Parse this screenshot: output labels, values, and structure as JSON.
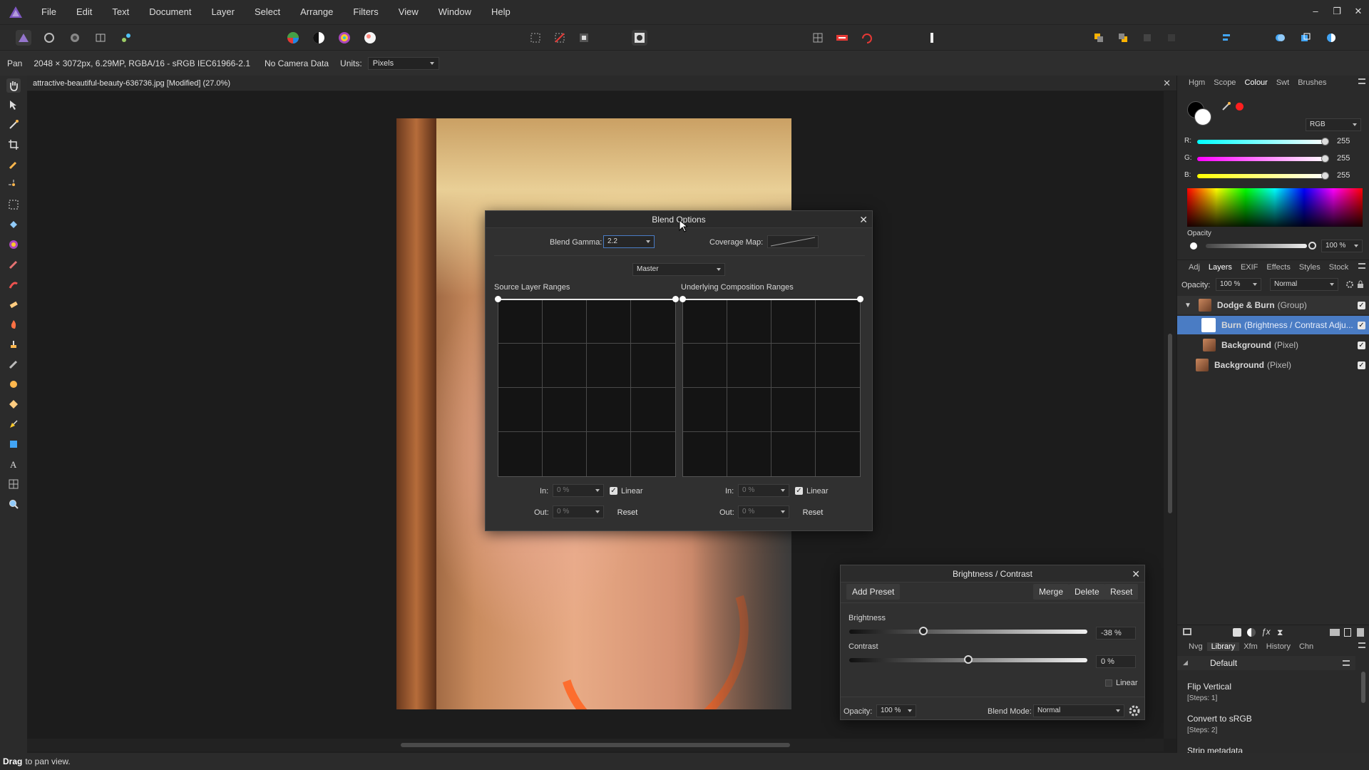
{
  "menubar": {
    "items": [
      "File",
      "Edit",
      "Text",
      "Document",
      "Layer",
      "Select",
      "Arrange",
      "Filters",
      "View",
      "Window",
      "Help"
    ],
    "window_controls": [
      "–",
      "❐",
      "✕"
    ]
  },
  "context": {
    "tool": "Pan",
    "doc_info": "2048 × 3072px, 6.29MP, RGBA/16 - sRGB IEC61966-2.1",
    "camera": "No Camera Data",
    "units_label": "Units:",
    "units_value": "Pixels"
  },
  "document": {
    "tab_title": "attractive-beautiful-beauty-636736.jpg [Modified] (27.0%)",
    "close": "✕"
  },
  "blend_options": {
    "title": "Blend Options",
    "close": "✕",
    "blend_gamma_label": "Blend Gamma:",
    "blend_gamma_value": "2.2",
    "coverage_map_label": "Coverage Map:",
    "channel": "Master",
    "source_label": "Source Layer Ranges",
    "underlying_label": "Underlying Composition Ranges",
    "source": {
      "in_label": "In:",
      "in_value": "0 %",
      "out_label": "Out:",
      "out_value": "0 %",
      "linear_label": "Linear",
      "reset": "Reset"
    },
    "underlying": {
      "in_label": "In:",
      "in_value": "0 %",
      "out_label": "Out:",
      "out_value": "0 %",
      "linear_label": "Linear",
      "reset": "Reset"
    }
  },
  "brightness_contrast": {
    "title": "Brightness / Contrast",
    "close": "✕",
    "add_preset": "Add Preset",
    "merge": "Merge",
    "delete": "Delete",
    "reset": "Reset",
    "brightness_label": "Brightness",
    "brightness_value": "-38 %",
    "brightness_level": -38,
    "contrast_label": "Contrast",
    "contrast_value": "0 %",
    "contrast_level": 0,
    "linear_label": "Linear",
    "opacity_label": "Opacity:",
    "opacity_value": "100 %",
    "blend_mode_label": "Blend Mode:",
    "blend_mode_value": "Normal"
  },
  "colour_panel": {
    "tabs": [
      "Hgm",
      "Scope",
      "Colour",
      "Swt",
      "Brushes"
    ],
    "active_tab": "Colour",
    "model": "RGB",
    "r_label": "R:",
    "r_value": "255",
    "g_label": "G:",
    "g_value": "255",
    "b_label": "B:",
    "b_value": "255",
    "opacity_label": "Opacity",
    "opacity_value": "100 %"
  },
  "layers_panel": {
    "tabs": [
      "Adj",
      "Layers",
      "EXIF",
      "Effects",
      "Styles",
      "Stock"
    ],
    "active_tab": "Layers",
    "opacity_label": "Opacity:",
    "opacity_value": "100 %",
    "blend_mode": "Normal",
    "layers": [
      {
        "name": "Dodge & Burn",
        "type": "(Group)"
      },
      {
        "name": "Burn",
        "type": "(Brightness / Contrast Adju..."
      },
      {
        "name": "Background",
        "type": "(Pixel)"
      },
      {
        "name": "Background",
        "type": "(Pixel)"
      }
    ]
  },
  "history_panel": {
    "tabs": [
      "Nvg",
      "Library",
      "Xfm",
      "History",
      "Chn"
    ],
    "active_tab": "Library",
    "category": "Default",
    "items": [
      {
        "name": "Flip Vertical",
        "steps": "[Steps: 1]"
      },
      {
        "name": "Convert to sRGB",
        "steps": "[Steps: 2]"
      },
      {
        "name": "Strip metadata",
        "steps": ""
      }
    ]
  },
  "status": {
    "bold": "Drag",
    "text": "to pan view."
  },
  "colors": {
    "accent": "#3d6fb6",
    "selected_row": "#4a7cc4"
  }
}
